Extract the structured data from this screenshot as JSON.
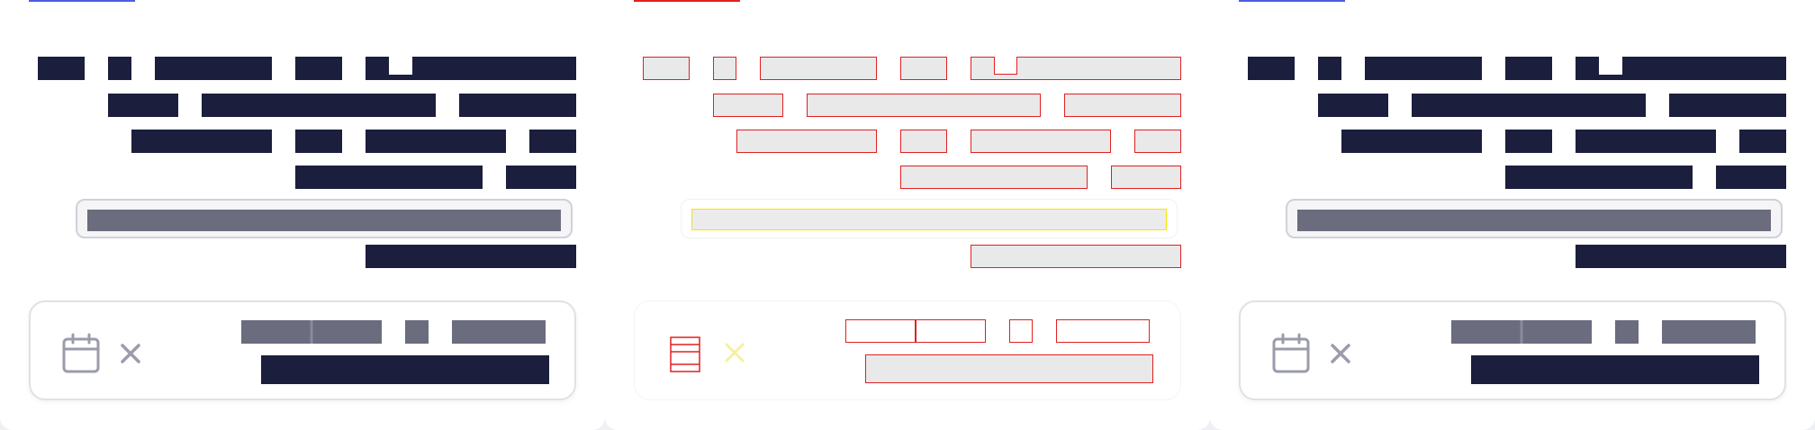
{
  "colors": {
    "background": "#eef0f4",
    "panel": "#ffffff",
    "redacted_text": "#1b1e3c",
    "redacted_muted": "#6b6c7e",
    "tab_indicator_blue": "#4a5ee0",
    "tab_indicator_red": "#e02020",
    "wireframe_outline": "#e02020",
    "wireframe_field_outline": "#f2e600"
  },
  "panels": [
    {
      "variant": "rendered",
      "tab_indicator_color": "#4a5ee0"
    },
    {
      "variant": "wireframe",
      "tab_indicator_color": "#e02020"
    },
    {
      "variant": "rendered",
      "tab_indicator_color": "#4a5ee0"
    }
  ],
  "icons": {
    "date": "calendar-icon",
    "clear": "close-icon"
  }
}
